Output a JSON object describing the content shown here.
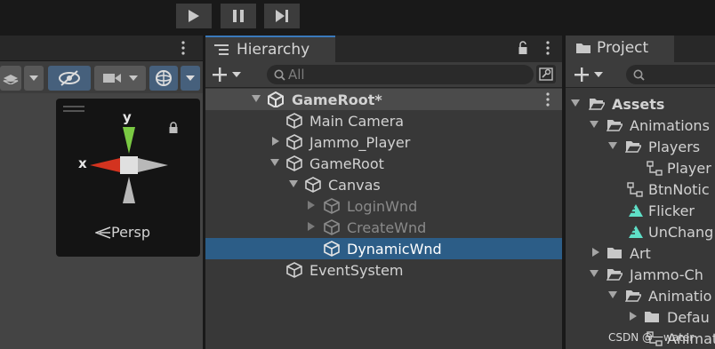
{
  "toolbar": {
    "play_label": "play-icon",
    "pause_label": "pause-icon",
    "step_label": "step-icon"
  },
  "scene": {
    "gizmo": {
      "y_axis": "y",
      "x_axis": "x",
      "projection": "Persp"
    }
  },
  "hierarchy": {
    "tab_title": "Hierarchy",
    "search_placeholder": "All",
    "rows": [
      {
        "label": "GameRoot*",
        "state": "scene"
      },
      {
        "label": "Main Camera",
        "state": "normal"
      },
      {
        "label": "Jammo_Player",
        "state": "normal"
      },
      {
        "label": "GameRoot",
        "state": "normal"
      },
      {
        "label": "Canvas",
        "state": "normal"
      },
      {
        "label": "LoginWnd",
        "state": "inactive"
      },
      {
        "label": "CreateWnd",
        "state": "inactive"
      },
      {
        "label": "DynamicWnd",
        "state": "selected"
      },
      {
        "label": "EventSystem",
        "state": "normal"
      }
    ]
  },
  "project": {
    "tab_title": "Project",
    "rows": [
      {
        "label": "Assets"
      },
      {
        "label": "Animations"
      },
      {
        "label": "Players"
      },
      {
        "label": "Player"
      },
      {
        "label": "BtnNotic"
      },
      {
        "label": "Flicker"
      },
      {
        "label": "UnChang"
      },
      {
        "label": "Art"
      },
      {
        "label": "Jammo-Ch"
      },
      {
        "label": "Animatio"
      },
      {
        "label": "Defau"
      },
      {
        "label": "Animat"
      }
    ]
  },
  "watermark": "CSDN @一water",
  "colors": {
    "selection": "#2c5d87",
    "tab_accent": "#3a79bb",
    "y_axis": "#7ac943",
    "x_axis": "#d3331f"
  }
}
